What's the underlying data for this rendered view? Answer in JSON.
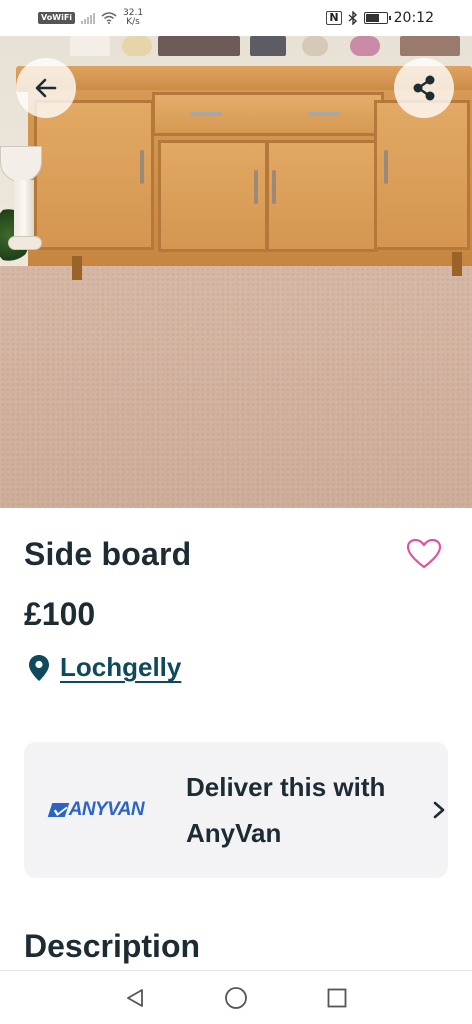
{
  "status_bar": {
    "network_label": "VoWiFi",
    "speed_value": "32.1",
    "speed_unit": "K/s",
    "time": "20:12",
    "icons": [
      "signal-icon",
      "wifi-icon",
      "nfc-icon",
      "bluetooth-icon",
      "battery-icon"
    ]
  },
  "listing": {
    "photo_description_icons": [
      "back-arrow-icon",
      "share-icon"
    ],
    "title": "Side board",
    "price": "£100",
    "location": "Lochgelly"
  },
  "delivery": {
    "partner_logo_text": "ANYVAN",
    "text": "Deliver this with AnyVan"
  },
  "sections": {
    "description_heading": "Description"
  },
  "colors": {
    "text_primary": "#1d2b33",
    "link": "#0e4a5c",
    "favourite_heart": "#e0559a",
    "anyvan_brand": "#2c64c6",
    "card_background": "#f3f3f5"
  },
  "nav_bar": {
    "icons": [
      "nav-back-icon",
      "nav-home-icon",
      "nav-recents-icon"
    ]
  }
}
